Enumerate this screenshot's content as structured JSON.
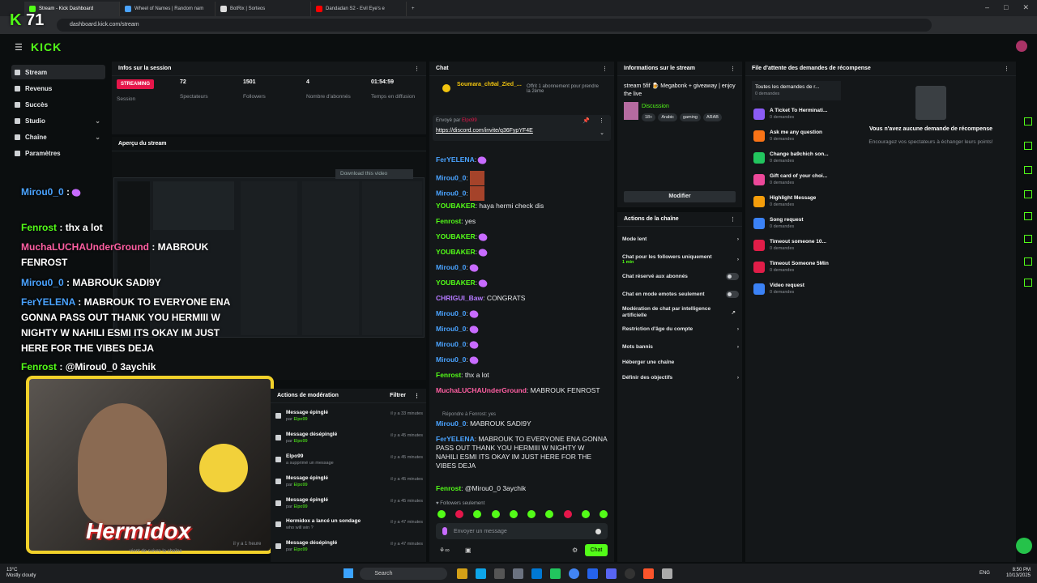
{
  "browser": {
    "tabs": [
      "Stream - Kick Dashboard",
      "Wheel of Names | Random nam",
      "BotRix | Sorteos",
      "Dandadan S2 - Evil Eye's e"
    ],
    "url": "dashboard.kick.com/stream"
  },
  "overlay_counter": "71",
  "brand": "KICK",
  "sidebar": {
    "items": [
      {
        "label": "Stream"
      },
      {
        "label": "Revenus"
      },
      {
        "label": "Succès"
      },
      {
        "label": "Studio"
      },
      {
        "label": "Chaîne"
      },
      {
        "label": "Paramètres"
      }
    ]
  },
  "session": {
    "title": "Infos sur la session",
    "status": "STREAMING",
    "status_label": "Session",
    "stats": [
      {
        "value": "72",
        "label": "Spectateurs"
      },
      {
        "value": "1501",
        "label": "Followers"
      },
      {
        "value": "4",
        "label": "Nombre d'abonnés"
      },
      {
        "value": "01:54:59",
        "label": "Temps en diffusion"
      }
    ]
  },
  "preview": {
    "title": "Aperçu du stream",
    "download": "Download this video"
  },
  "overlay_chat": [
    {
      "user": "Mirou0_0",
      "text": "",
      "color": "blue"
    },
    {
      "user": "Fenrost",
      "text": "thx a lot",
      "color": "green"
    },
    {
      "user": "MuchaLUCHAUnderGround",
      "text": "MABROUK FENROST",
      "color": "pink"
    },
    {
      "user": "Mirou0_0",
      "text": "MABROUK SADI9Y",
      "color": "blue"
    },
    {
      "user": "FerYELENA",
      "text": "MABROUK TO EVERYONE ENA GONNA PASS OUT THANK YOU HERMIII W NIGHTY W NAHILI ESMI ITS OKAY IM JUST HERE FOR THE VIBES DEJA",
      "color": "cyan"
    },
    {
      "user": "Fenrost",
      "text": "@Mirou0_0 3aychik",
      "color": "green"
    }
  ],
  "webcam_name": "Hermidox",
  "follow_notice": "vient de suivre la chaîne",
  "follow_time": "il y a 1 heure",
  "moderation": {
    "title": "Actions de modération",
    "filter": "Filtrer",
    "rows": [
      {
        "title": "Message épinglé",
        "by": "par",
        "user": "Elpo99",
        "time": "il y a 33 minutes"
      },
      {
        "title": "Message désépinglé",
        "by": "par",
        "user": "Elpo99",
        "time": "il y a 45 minutes"
      },
      {
        "title": "Elpo99",
        "by": "a supprimé un message",
        "user": "",
        "time": "il y a 45 minutes"
      },
      {
        "title": "Message épinglé",
        "by": "par",
        "user": "Elpo99",
        "time": "il y a 45 minutes"
      },
      {
        "title": "Message épinglé",
        "by": "par",
        "user": "Elpo99",
        "time": "il y a 45 minutes"
      },
      {
        "title": "Hermidox a lancé un sondage",
        "by": "who will win ?",
        "user": "",
        "time": "il y a 47 minutes"
      },
      {
        "title": "Message désépinglé",
        "by": "par",
        "user": "Elpo99",
        "time": "il y a 47 minutes"
      }
    ]
  },
  "chat": {
    "title": "Chat",
    "gift_user": "Soumara_ch9al_Zied_...",
    "gift_text": "Offrit 1 abonnement pour prendre la 2ème",
    "pinned_by": "Envoyé par",
    "pinned_user": "Elpo99",
    "pinned_link": "https://discord.com/invite/q36FypYF4E",
    "messages": [
      {
        "user": "FerYELENA",
        "text": "",
        "color": "cyan"
      },
      {
        "user": "Mirou0_0",
        "text": "",
        "color": "blue"
      },
      {
        "user": "Mirou0_0",
        "text": "",
        "color": "blue"
      },
      {
        "user": "YOUBAKER",
        "text": "haya hermi check dis",
        "color": "green"
      },
      {
        "user": "Fenrost",
        "text": "yes",
        "color": "green"
      },
      {
        "user": "YOUBAKER",
        "text": "",
        "color": "green"
      },
      {
        "user": "YOUBAKER",
        "text": "",
        "color": "green"
      },
      {
        "user": "Mirou0_0",
        "text": "",
        "color": "blue"
      },
      {
        "user": "YOUBAKER",
        "text": "",
        "color": "green"
      },
      {
        "user": "CHRIGUI_Baw",
        "text": "CONGRATS",
        "color": "violet"
      },
      {
        "user": "Mirou0_0",
        "text": "",
        "color": "blue"
      },
      {
        "user": "Mirou0_0",
        "text": "",
        "color": "blue"
      },
      {
        "user": "Mirou0_0",
        "text": "",
        "color": "blue"
      },
      {
        "user": "Mirou0_0",
        "text": "",
        "color": "blue"
      },
      {
        "user": "Fenrost",
        "text": "thx a lot",
        "color": "green"
      },
      {
        "user": "MuchaLUCHAUnderGround",
        "text": "MABROUK FENROST",
        "color": "pink"
      }
    ],
    "reply_to": "Répondre à Fenrost: yes",
    "messages2": [
      {
        "user": "Mirou0_0",
        "text": "MABROUK SADI9Y",
        "color": "blue"
      },
      {
        "user": "FerYELENA",
        "text": "MABROUK TO EVERYONE ENA GONNA PASS OUT THANK YOU HERMIII W NIGHTY W NAHILI ESMI ITS OKAY IM JUST HERE FOR THE VIBES DEJA",
        "color": "cyan"
      },
      {
        "user": "Fenrost",
        "text": "@Mirou0_0 3aychik",
        "color": "green"
      }
    ],
    "followers_only": "Followers seulement",
    "input_placeholder": "Envoyer un message",
    "send": "Chat"
  },
  "stream_info": {
    "title": "Informations sur le stream",
    "stream_title": "stream 5fif 🍺 Megabonk + giveaway | enjoy the live",
    "category": "Discussion",
    "tags": [
      "18+",
      "Arabic",
      "gaming",
      "ARAB"
    ],
    "edit": "Modifier"
  },
  "channel_actions": {
    "title": "Actions de la chaîne",
    "items": [
      {
        "label": "Mode lent",
        "sub": "",
        "kind": "chevron"
      },
      {
        "label": "Chat pour les followers uniquement",
        "sub": "1 min",
        "kind": "chevron"
      },
      {
        "label": "Chat réservé aux abonnés",
        "sub": "",
        "kind": "toggle"
      },
      {
        "label": "Chat en mode emotes seulement",
        "sub": "",
        "kind": "toggle"
      },
      {
        "label": "Modération de chat par intelligence artificielle",
        "sub": "",
        "kind": "ext"
      },
      {
        "label": "Restriction d'âge du compte",
        "sub": "",
        "kind": "chevron"
      },
      {
        "label": "Mots bannis",
        "sub": "",
        "kind": "chevron"
      },
      {
        "label": "Héberger une chaîne",
        "sub": "",
        "kind": "none"
      },
      {
        "label": "Définir des objectifs",
        "sub": "",
        "kind": "chevron"
      }
    ]
  },
  "rewards": {
    "title": "File d'attente des demandes de récompense",
    "all_label": "Toutes les demandes de r...",
    "all_count": "0 demandes",
    "empty_title": "Vous n'avez aucune demande de récompense",
    "empty_sub": "Encouragez vos spectateurs à échanger leurs points!",
    "items": [
      {
        "name": "A Ticket To Herminati...",
        "count": "0 demandes",
        "color": "#8b5cf6"
      },
      {
        "name": "Ask me any question",
        "count": "0 demandes",
        "color": "#f97316"
      },
      {
        "name": "Change ba9chich son...",
        "count": "0 demandes",
        "color": "#22c55e"
      },
      {
        "name": "Gift card of your choi...",
        "count": "0 demandes",
        "color": "#ec4899"
      },
      {
        "name": "Highlight Message",
        "count": "0 demandes",
        "color": "#f59e0b"
      },
      {
        "name": "Song request",
        "count": "0 demandes",
        "color": "#3b82f6"
      },
      {
        "name": "Timeout someone 10...",
        "count": "0 demandes",
        "color": "#e11d48"
      },
      {
        "name": "Timeout Someone 5Min",
        "count": "0 demandes",
        "color": "#e11d48"
      },
      {
        "name": "Video request",
        "count": "0 demandes",
        "color": "#3b82f6"
      }
    ]
  },
  "taskbar": {
    "weather_temp": "13°C",
    "weather_desc": "Mostly cloudy",
    "search": "Search",
    "lang": "ENG",
    "time": "8:50 PM",
    "date": "10/13/2025"
  }
}
